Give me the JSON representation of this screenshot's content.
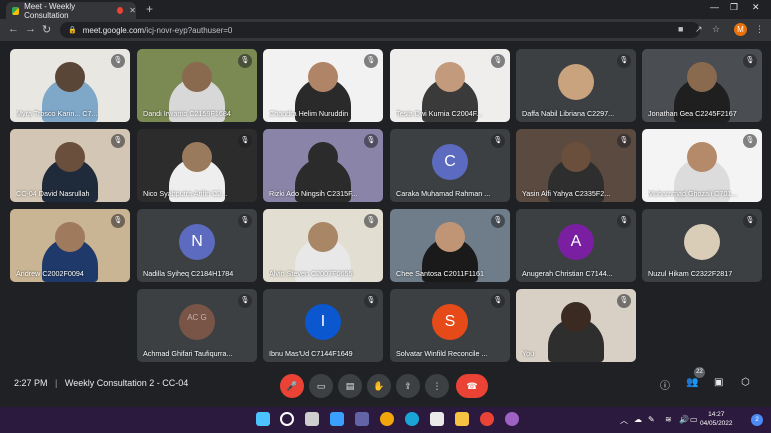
{
  "browser": {
    "tab_title": "Meet - Weekly Consultation",
    "url_host": "meet.google.com",
    "url_path": "/icj-novr-eyp?authuser=0",
    "profile_initial": "M"
  },
  "participants": [
    {
      "name": "Myra Trosco Karin... C7...",
      "type": "video",
      "bg": "#e9e7e2",
      "skin": "#5a4636",
      "shirt": "#7fa7c8"
    },
    {
      "name": "Dandi Irwanto C2159F1684",
      "type": "video",
      "bg": "#7a8a52",
      "skin": "#8a6a4f",
      "shirt": "#d8d8d8"
    },
    {
      "name": "Chandra Helim Nuruddin",
      "type": "video",
      "bg": "#f2f2f2",
      "skin": "#b08466",
      "shirt": "#2a2a2a"
    },
    {
      "name": "Tesia Dwi Kurnia C2004F...",
      "type": "video",
      "bg": "#efeeed",
      "skin": "#c49a7c",
      "shirt": "#3a3a3a"
    },
    {
      "name": "Daffa Nabil Libriana C2297...",
      "type": "photo",
      "bg": "#3c4043",
      "color": "#c8a37d"
    },
    {
      "name": "Jonathan Gea C2245F2167",
      "type": "video",
      "bg": "#4a4d52",
      "skin": "#8a6a4f",
      "shirt": "#1f1f1f"
    },
    {
      "name": "CC-04 David Nasrullah",
      "type": "video",
      "bg": "#d3c6b4",
      "skin": "#6b4f3d",
      "shirt": "#1f2a3a"
    },
    {
      "name": "Nico Syahputra Arifin C2...",
      "type": "video",
      "bg": "#2c2c2c",
      "skin": "#9a7a5d",
      "shirt": "#eeeeee"
    },
    {
      "name": "Rizki Ado Ningsih C2315F...",
      "type": "video",
      "bg": "#8a84a8",
      "skin": "#2b2b2b",
      "shirt": "#2b2b2b"
    },
    {
      "name": "Caraka Muhamad Rahman ...",
      "type": "letter",
      "letter": "C",
      "color": "#5c6bc0"
    },
    {
      "name": "Yasin Alfi Yahya C2335F2...",
      "type": "video",
      "bg": "#5a4a40",
      "skin": "#6a4f3c",
      "shirt": "#2e2e2e"
    },
    {
      "name": "Muhammad Ghozali C701...",
      "type": "video",
      "bg": "#f4f4f4",
      "skin": "#b58a6a",
      "shirt": "#dcdcdc"
    },
    {
      "name": "Andrew C2002F0094",
      "type": "video",
      "bg": "#c9b493",
      "skin": "#a07a5c",
      "shirt": "#1f3a6a"
    },
    {
      "name": "Nadilla Syiheq C2184H1784",
      "type": "letter",
      "letter": "N",
      "color": "#5c6bc0"
    },
    {
      "name": "Alvin Steven C2007F0655",
      "type": "video",
      "bg": "#e3ded2",
      "skin": "#a88666",
      "shirt": "#e8e8e8"
    },
    {
      "name": "Chee Santosa C2011F1161",
      "type": "video",
      "bg": "#6f7d8a",
      "skin": "#c09576",
      "shirt": "#1a1a1a"
    },
    {
      "name": "Anugerah Christian C7144...",
      "type": "letter",
      "letter": "A",
      "color": "#7b1fa2"
    },
    {
      "name": "Nuzul Hikam C2322F2817",
      "type": "photo",
      "bg": "#3c4043",
      "color": "#d9cdb8"
    },
    {
      "name": "Achmad Ghifari Taufiqurra...",
      "type": "letter",
      "letter": "AC G",
      "color": "#795548"
    },
    {
      "name": "Ibnu Mas'Ud C7144F1649",
      "type": "letter",
      "letter": "I",
      "color": "#0b57d0"
    },
    {
      "name": "Solvatar Winfild Reconcile ...",
      "type": "letter",
      "letter": "S",
      "color": "#e64a19"
    },
    {
      "name": "You",
      "type": "video",
      "bg": "#d8d0c4",
      "skin": "#3a2a22",
      "shirt": "#2e2e2e"
    }
  ],
  "meeting": {
    "time": "2:27 PM",
    "separator": "|",
    "title": "Weekly Consultation 2 - CC-04",
    "participant_count": "22"
  },
  "taskbar": {
    "time": "14:27",
    "date": "04/05/2022",
    "notification_count": "2"
  }
}
